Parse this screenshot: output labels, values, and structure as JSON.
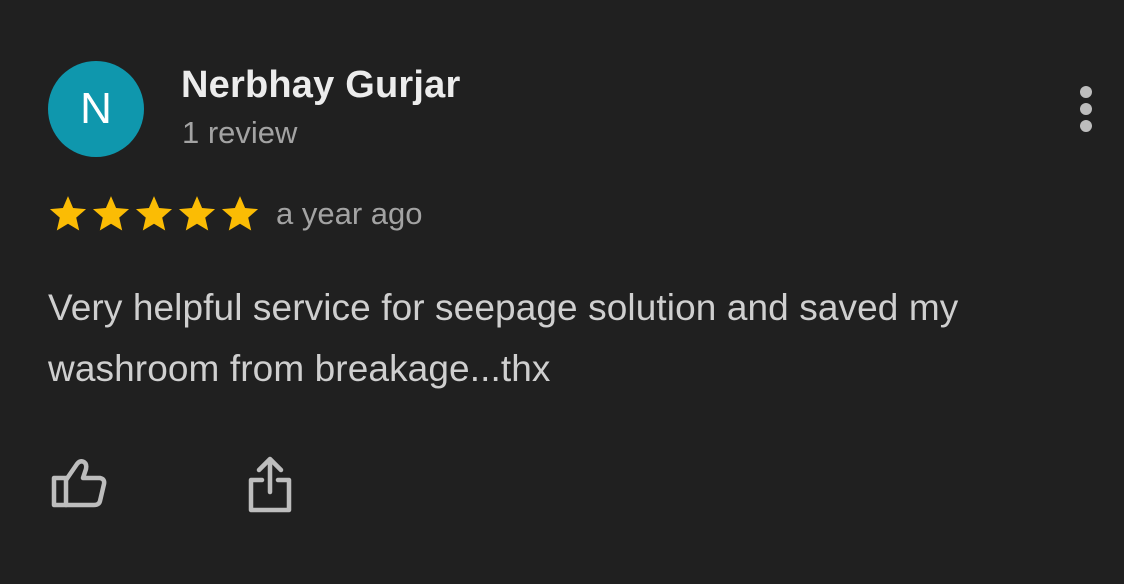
{
  "review": {
    "avatar_initial": "N",
    "author_name": "Nerbhay Gurjar",
    "review_count": "1 review",
    "rating": 5,
    "rating_max": 5,
    "time_ago": "a year ago",
    "text": "Very helpful service for seepage solution and saved my washroom from breakage...thx"
  },
  "icons": {
    "more": "more-vertical-icon",
    "star": "star-icon",
    "like": "thumbs-up-icon",
    "share": "share-icon"
  },
  "colors": {
    "background": "#202020",
    "avatar": "#0f97ad",
    "star": "#fbbc04",
    "name": "#ececec",
    "secondary_text": "#a3a3a3",
    "body_text": "#cfcfcf",
    "icon": "#bdbdbd"
  }
}
